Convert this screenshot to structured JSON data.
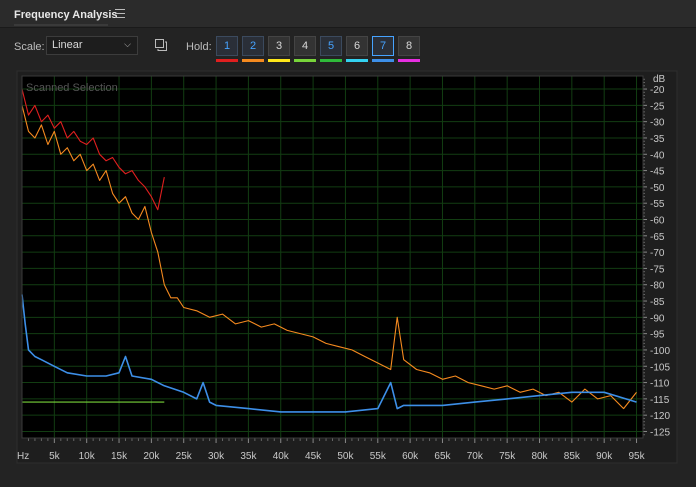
{
  "panel": {
    "title": "Frequency Analysis",
    "menu_icon": "hamburger-menu-icon"
  },
  "toolbar": {
    "scale_label": "Scale:",
    "scale_value": "Linear",
    "copy_icon": "copy-to-clipboard-icon",
    "hold_label": "Hold:",
    "hold_buttons": [
      {
        "label": "1",
        "color": "#e01f1f",
        "state": "on"
      },
      {
        "label": "2",
        "color": "#f58a1f",
        "state": "on"
      },
      {
        "label": "3",
        "color": "#ffe81a",
        "state": "off"
      },
      {
        "label": "4",
        "color": "#78d43a",
        "state": "off"
      },
      {
        "label": "5",
        "color": "#2fba3a",
        "state": "on"
      },
      {
        "label": "6",
        "color": "#34d2f0",
        "state": "off"
      },
      {
        "label": "7",
        "color": "#3d8fe8",
        "state": "on-active"
      },
      {
        "label": "8",
        "color": "#e62ee0",
        "state": "off"
      }
    ]
  },
  "chart_data": {
    "type": "line",
    "annotation": "Scanned Selection",
    "xunit": "Hz",
    "yunit": "dB",
    "x_ticks": [
      "5k",
      "10k",
      "15k",
      "20k",
      "25k",
      "30k",
      "35k",
      "40k",
      "45k",
      "50k",
      "55k",
      "60k",
      "65k",
      "70k",
      "75k",
      "80k",
      "85k",
      "90k",
      "95k"
    ],
    "y_ticks": [
      "-20",
      "-25",
      "-30",
      "-35",
      "-40",
      "-45",
      "-50",
      "-55",
      "-60",
      "-65",
      "-70",
      "-75",
      "-80",
      "-85",
      "-90",
      "-95",
      "-100",
      "-105",
      "-110",
      "-115",
      "-120",
      "-125"
    ],
    "xlim": [
      0,
      96000
    ],
    "ylim": [
      -127,
      -16
    ],
    "grid": true,
    "series": [
      {
        "color": "#e01f1f",
        "x": [
          0,
          1000,
          2000,
          3000,
          4000,
          5000,
          6000,
          7000,
          8000,
          9000,
          10000,
          11000,
          12000,
          13000,
          14000,
          15000,
          16000,
          17000,
          18000,
          19000,
          20000,
          21000,
          22000
        ],
        "y": [
          -20,
          -28,
          -25,
          -30,
          -28,
          -32,
          -30,
          -35,
          -33,
          -36,
          -37,
          -35,
          -40,
          -42,
          -41,
          -44,
          -46,
          -45,
          -48,
          -50,
          -53,
          -57,
          -47
        ]
      },
      {
        "color": "#f58a1f",
        "x": [
          0,
          1000,
          2000,
          3000,
          4000,
          5000,
          6000,
          7000,
          8000,
          9000,
          10000,
          11000,
          12000,
          13000,
          14000,
          15000,
          16000,
          17000,
          18000,
          19000,
          20000,
          21000,
          22000,
          23000,
          24000,
          25000,
          27000,
          29000,
          31000,
          33000,
          35000,
          37000,
          39000,
          41000,
          43000,
          45000,
          47000,
          49000,
          51000,
          53000,
          55000,
          57000,
          58000,
          59000,
          61000,
          63000,
          65000,
          67000,
          69000,
          71000,
          73000,
          75000,
          77000,
          79000,
          81000,
          83000,
          85000,
          87000,
          89000,
          91000,
          93000,
          95000
        ],
        "y": [
          -25,
          -33,
          -35,
          -31,
          -37,
          -33,
          -40,
          -38,
          -42,
          -40,
          -45,
          -43,
          -48,
          -45,
          -52,
          -55,
          -53,
          -58,
          -60,
          -56,
          -64,
          -70,
          -80,
          -84,
          -84,
          -87,
          -88,
          -90,
          -89,
          -92,
          -91,
          -93,
          -92,
          -94,
          -95,
          -96,
          -98,
          -99,
          -100,
          -102,
          -104,
          -106,
          -90,
          -103,
          -106,
          -107,
          -109,
          -108,
          -110,
          -111,
          -112,
          -111,
          -113,
          -112,
          -114,
          -113,
          -116,
          -112,
          -115,
          -114,
          -118,
          -113
        ]
      },
      {
        "color": "#3d8fe8",
        "x": [
          0,
          500,
          1000,
          2000,
          3000,
          5000,
          7000,
          10000,
          13000,
          15000,
          16000,
          17000,
          20000,
          21000,
          22000,
          25000,
          27000,
          28000,
          29000,
          30000,
          35000,
          40000,
          45000,
          50000,
          55000,
          57000,
          58000,
          59000,
          60000,
          65000,
          70000,
          75000,
          80000,
          85000,
          90000,
          95000
        ],
        "y": [
          -83,
          -92,
          -100,
          -102,
          -103,
          -105,
          -107,
          -108,
          -108,
          -107,
          -102,
          -108,
          -109,
          -110,
          -111,
          -113,
          -115,
          -110,
          -116,
          -117,
          -118,
          -119,
          -119,
          -119,
          -118,
          -110,
          -118,
          -117,
          -117,
          -117,
          -116,
          -115,
          -114,
          -113,
          -113,
          -116
        ]
      },
      {
        "color": "#78d43a",
        "x": [
          0,
          5000,
          10000,
          15000,
          20000,
          22000
        ],
        "y": [
          -116,
          -116,
          -116,
          -116,
          -116,
          -116
        ]
      }
    ]
  }
}
